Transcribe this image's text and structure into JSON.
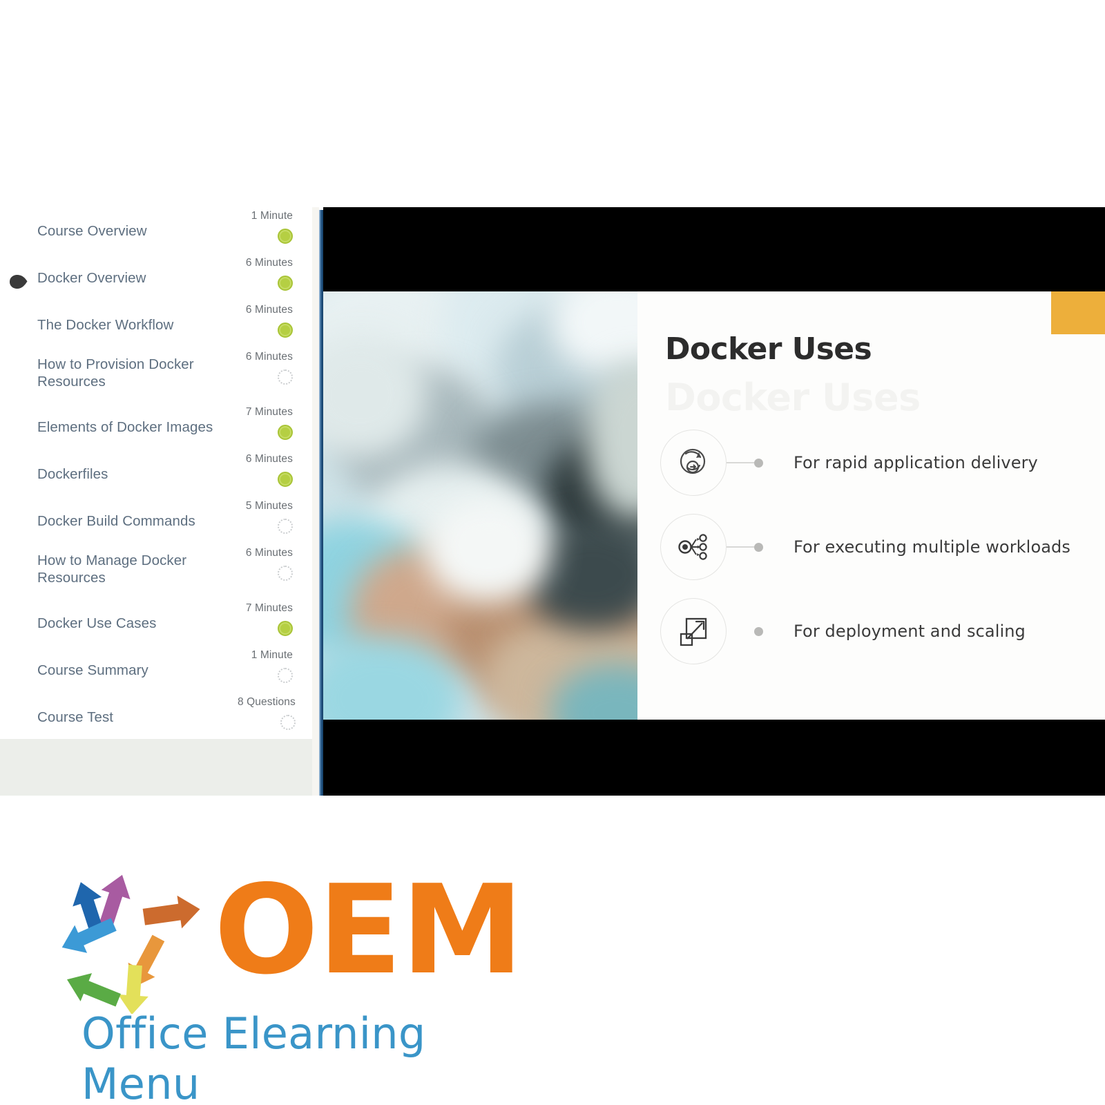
{
  "player": {
    "curriculum": {
      "lessons": [
        {
          "title": "Course Overview",
          "duration": "1 Minute",
          "status": "done",
          "active": false
        },
        {
          "title": "Docker Overview",
          "duration": "6 Minutes",
          "status": "done",
          "active": true
        },
        {
          "title": "The Docker Workflow",
          "duration": "6 Minutes",
          "status": "done",
          "active": false
        },
        {
          "title": "How to Provision Docker Resources",
          "duration": "6 Minutes",
          "status": "todo",
          "active": false
        },
        {
          "title": "Elements of Docker Images",
          "duration": "7 Minutes",
          "status": "done",
          "active": false
        },
        {
          "title": "Dockerfiles",
          "duration": "6 Minutes",
          "status": "done",
          "active": false
        },
        {
          "title": "Docker Build Commands",
          "duration": "5 Minutes",
          "status": "todo",
          "active": false
        },
        {
          "title": "How to Manage Docker Resources",
          "duration": "6 Minutes",
          "status": "todo",
          "active": false
        },
        {
          "title": "Docker Use Cases",
          "duration": "7 Minutes",
          "status": "done",
          "active": false
        },
        {
          "title": "Course Summary",
          "duration": "1 Minute",
          "status": "todo",
          "active": false
        },
        {
          "title": "Course Test",
          "duration": "8 Questions",
          "status": "todo",
          "active": false
        }
      ]
    },
    "slide": {
      "title": "Docker Uses",
      "ghost_text": "Docker Uses",
      "accent_color": "#edaf3b",
      "bullets": [
        {
          "text": "For rapid application delivery",
          "icon": "delivery-cycle-icon",
          "connector": true
        },
        {
          "text": "For executing multiple workloads",
          "icon": "workload-network-icon",
          "connector": true
        },
        {
          "text": "For deployment and scaling",
          "icon": "scaling-arrow-icon",
          "connector": false
        }
      ]
    }
  },
  "logo": {
    "wordmark": "OEM",
    "tagline": "Office Elearning Menu",
    "wordmark_color": "#ef7c18",
    "tagline_color": "#3a95c8",
    "arrow_colors": [
      "#a85ba1",
      "#1f66ad",
      "#3c9ad6",
      "#cc6b2e",
      "#e8973c",
      "#e3e05a",
      "#5aab45"
    ]
  }
}
